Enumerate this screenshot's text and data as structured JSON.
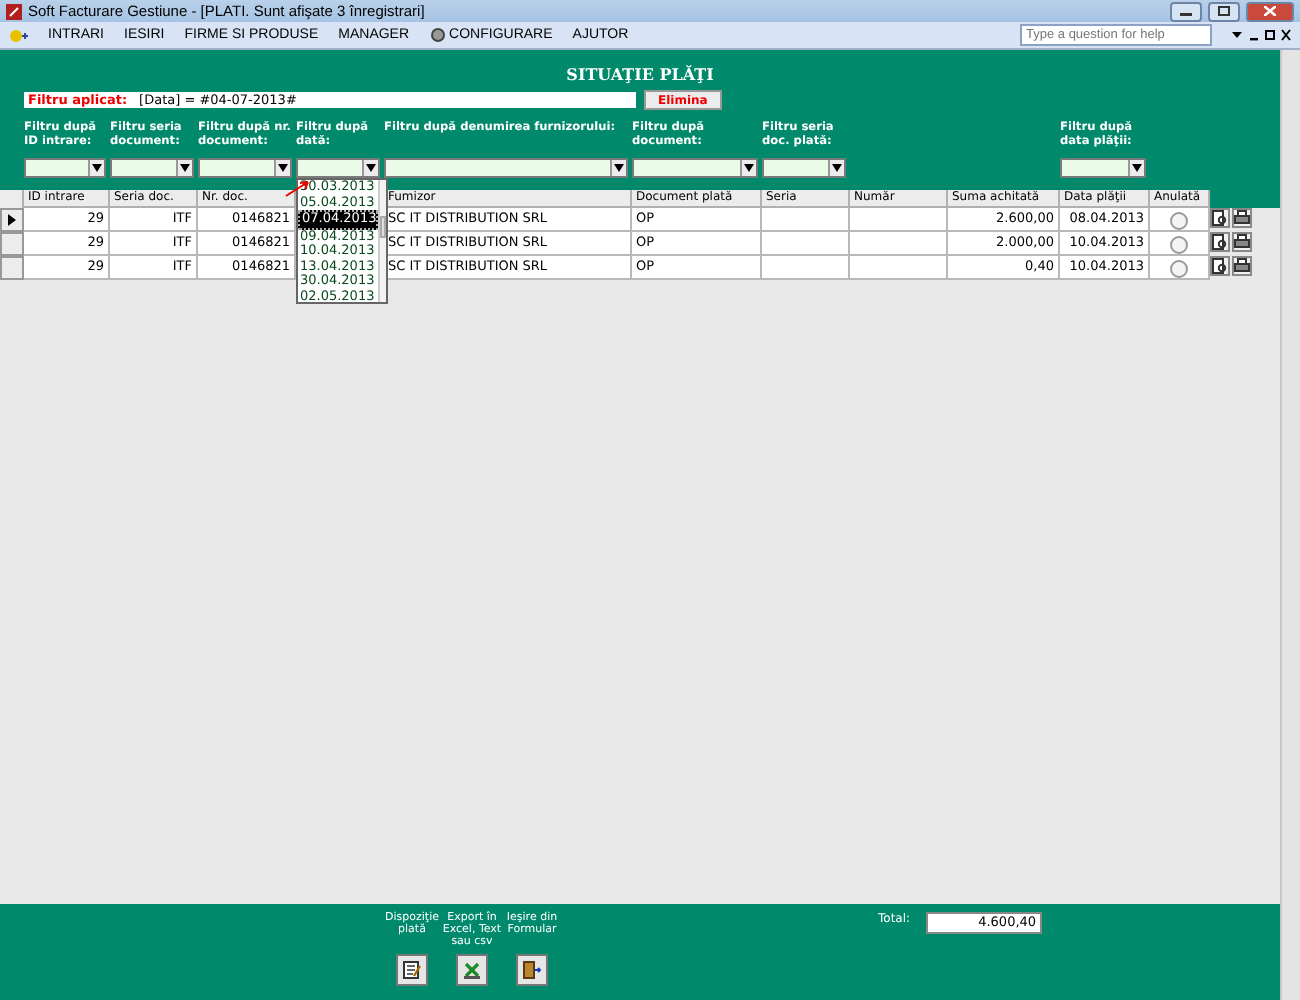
{
  "window": {
    "title": "Soft Facturare Gestiune - [PLATI. Sunt afişate 3 înregistrari]"
  },
  "menu": [
    {
      "label": "INTRARI",
      "kind": "plain"
    },
    {
      "label": "IESIRI",
      "kind": "plain"
    },
    {
      "label": "FIRME SI PRODUSE",
      "kind": "plain"
    },
    {
      "label": "MANAGER",
      "kind": "plain"
    },
    {
      "label": "CONFIGURARE",
      "kind": "icon"
    },
    {
      "label": "AJUTOR",
      "kind": "plain"
    }
  ],
  "help": {
    "placeholder": "Type a question for help"
  },
  "form_title": "SITUAŢIE PLĂŢI",
  "applied_filter": {
    "label": "Filtru aplicat:",
    "value": "[Data] = #04-07-2013#",
    "button": "Elimina"
  },
  "columns": [
    {
      "header": "ID intrare",
      "filter": "Filtru după ID intrare:"
    },
    {
      "header": "Seria doc.",
      "filter": "Filtru seria document:"
    },
    {
      "header": "Nr. doc.",
      "filter": "Filtru după nr. document:"
    },
    {
      "filter": "Filtru după dată:",
      "dropdown": [
        {
          "label": "30.03.2013",
          "selected": false
        },
        {
          "label": "05.04.2013",
          "selected": false
        },
        {
          "label": "07.04.2013",
          "selected": true
        },
        {
          "label": "09.04.2013",
          "selected": false
        },
        {
          "label": "10.04.2013",
          "selected": false
        },
        {
          "label": "13.04.2013",
          "selected": false
        },
        {
          "label": "30.04.2013",
          "selected": false
        },
        {
          "label": "02.05.2013",
          "selected": false
        }
      ]
    },
    {
      "header": "Fumizor",
      "filter": "Filtru după denumirea furnizorului:"
    },
    {
      "header": "Document plată",
      "filter": "Filtru după document:"
    },
    {
      "header": "Seria",
      "filter": "Filtru seria doc. plată:"
    },
    {
      "header": "Număr"
    },
    {
      "header": "Suma achitată"
    },
    {
      "header": "Data plăţii",
      "filter": "Filtru după data plăţii:"
    },
    {
      "header": "Anulată"
    }
  ],
  "rows": [
    {
      "selected": true,
      "cancelled": false,
      "cells": [
        "29",
        "ITF",
        "0146821",
        null,
        "SC IT DISTRIBUTION SRL",
        "OP",
        null,
        null,
        "2.600,00",
        "08.04.2013"
      ]
    },
    {
      "selected": false,
      "cancelled": false,
      "cells": [
        "29",
        "ITF",
        "0146821",
        null,
        "SC IT DISTRIBUTION SRL",
        "OP",
        null,
        null,
        "2.000,00",
        "10.04.2013"
      ]
    },
    {
      "selected": false,
      "cancelled": false,
      "cells": [
        "29",
        "ITF",
        "0146821",
        null,
        "SC IT DISTRIBUTION SRL",
        "OP",
        null,
        null,
        "0,40",
        "10.04.2013"
      ]
    }
  ],
  "footer": {
    "buttons": [
      {
        "kind": "payment",
        "label": "Dispoziţie plată"
      },
      {
        "kind": "export",
        "label": "Export în Excel, Text sau csv"
      },
      {
        "kind": "exit",
        "label": "Ieşire din Formular"
      }
    ],
    "total_label": "Total:",
    "total_value": "4.600,40"
  }
}
